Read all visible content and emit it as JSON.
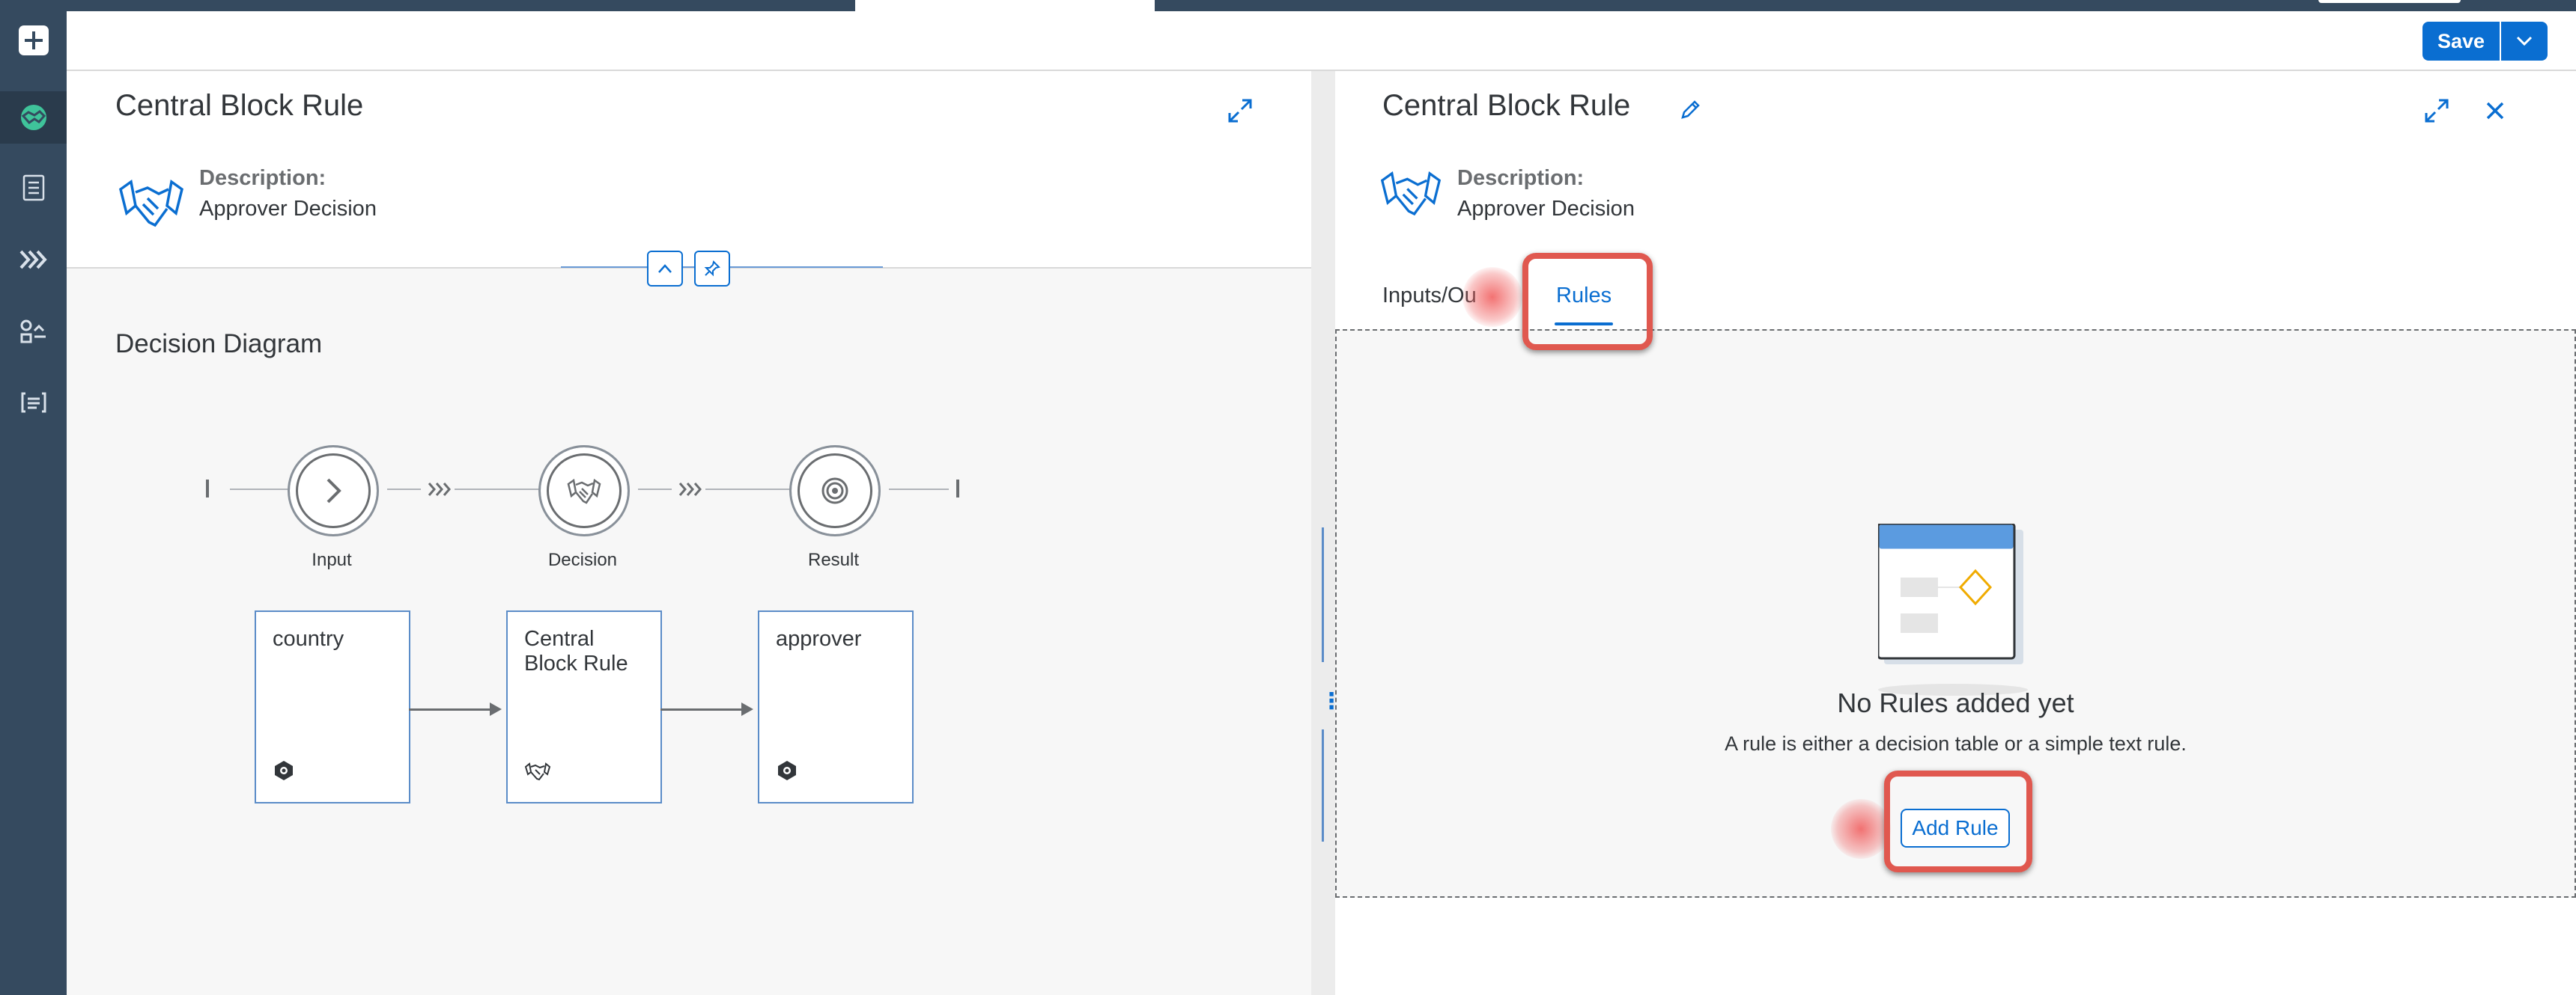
{
  "toolbar": {
    "save_label": "Save"
  },
  "left_panel": {
    "title": "Central Block Rule",
    "description_label": "Description:",
    "description_value": "Approver Decision",
    "diagram_title": "Decision Diagram",
    "nodes": [
      {
        "label": "Input",
        "icon": "chevron-right-icon"
      },
      {
        "label": "Decision",
        "icon": "handshake-icon"
      },
      {
        "label": "Result",
        "icon": "target-icon"
      }
    ],
    "cards": [
      {
        "title": "country",
        "icon": "data-object-icon"
      },
      {
        "title": "Central Block Rule",
        "icon": "handshake-icon"
      },
      {
        "title": "approver",
        "icon": "data-object-icon"
      }
    ]
  },
  "right_panel": {
    "title": "Central Block Rule",
    "description_label": "Description:",
    "description_value": "Approver Decision",
    "tabs": [
      {
        "label": "Inputs/Ou"
      },
      {
        "label": "Rules",
        "selected": true
      }
    ],
    "empty_title": "No Rules added yet",
    "empty_subtitle": "A rule is either a decision table or a simple text rule.",
    "add_rule_label": "Add Rule"
  },
  "colors": {
    "shell": "#354a5f",
    "accent": "#0a6ed1",
    "highlight": "#e0584f"
  }
}
